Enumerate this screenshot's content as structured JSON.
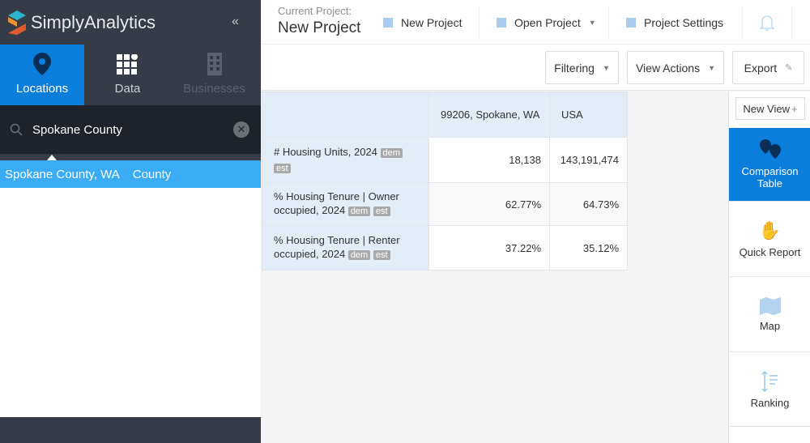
{
  "app": {
    "name": "SimplyAnalytics",
    "collapse_icon": "double-chevron-left-icon"
  },
  "sidebar": {
    "tabs": [
      {
        "label": "Locations",
        "icon": "map-pin-icon",
        "active": true
      },
      {
        "label": "Data",
        "icon": "grid-icon"
      },
      {
        "label": "Businesses",
        "icon": "building-icon",
        "disabled": true
      }
    ],
    "search": {
      "value": "Spokane County"
    },
    "results": [
      {
        "name": "Spokane County, WA",
        "type": "County"
      }
    ]
  },
  "header": {
    "current_project_label": "Current Project:",
    "project_name": "New Project",
    "new_project": "New Project",
    "open_project": "Open Project",
    "project_settings": "Project Settings"
  },
  "toolbar": {
    "filtering": "Filtering",
    "view_actions": "View Actions",
    "export": "Export"
  },
  "table": {
    "columns": [
      "99206, Spokane, WA",
      "USA"
    ],
    "rows": [
      {
        "label": "# Housing Units, 2024",
        "badges": [
          "dem",
          "est"
        ],
        "values": [
          "18,138",
          "143,191,474"
        ]
      },
      {
        "label": "% Housing Tenure | Owner occupied, 2024",
        "badges": [
          "dem",
          "est"
        ],
        "values": [
          "62.77%",
          "64.73%"
        ]
      },
      {
        "label": "% Housing Tenure | Renter occupied, 2024",
        "badges": [
          "dem",
          "est"
        ],
        "values": [
          "37.22%",
          "35.12%"
        ]
      }
    ]
  },
  "views": {
    "new_view": "New View",
    "items": [
      {
        "label": "Comparison Table",
        "active": true
      },
      {
        "label": "Quick Report"
      },
      {
        "label": "Map"
      },
      {
        "label": "Ranking"
      }
    ]
  },
  "colors": {
    "accent": "#0b7ddb",
    "highlight": "#3aabf5",
    "sidebar": "#353c47"
  }
}
